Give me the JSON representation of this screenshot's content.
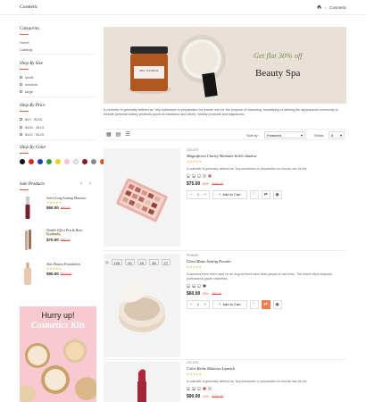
{
  "header": {
    "title": "Cosmetic",
    "breadcrumb_current": "Cosmetic",
    "home_icon": "home-icon"
  },
  "sidebar": {
    "categories_title": "Categories",
    "categories": [
      "Home",
      "Catalog"
    ],
    "size_title": "Shop By Size",
    "sizes": [
      "small",
      "medium",
      "large"
    ],
    "price_title": "Shop By Price",
    "prices": [
      "$10 - $100",
      "$100 - $110",
      "$110 - $120"
    ],
    "color_title": "Shop By Color",
    "colors": [
      "#111111",
      "#e0262b",
      "#1f3fb5",
      "#2e9e3a",
      "#f4d320",
      "#f3c1cf",
      "#e8e8e8",
      "#8a1c1c",
      "#8a8a8a",
      "#e0502e"
    ]
  },
  "sale": {
    "title": "Sale Products",
    "items": [
      {
        "name": "Sweet Long Lasting Mascara",
        "stars": "★★★★★",
        "price": "$60.00",
        "old": "$80.00"
      },
      {
        "name": "Double Effect Pen & Brow Eyeshado",
        "stars": "★★★★★",
        "price": "$70.00",
        "old": "$80.00"
      },
      {
        "name": "Skin Illusion Foundation",
        "stars": "★★★★★",
        "price": "$90.00",
        "old": "$100.00"
      }
    ]
  },
  "promo": {
    "line1": "Hurry up!",
    "line2": "Cosmetics Kits"
  },
  "banner": {
    "offer": "Get flat 30% off",
    "title": "Beauty Spa",
    "candle_label": "ABL CANDLE"
  },
  "category_description": "A cosmetic is generally defined as \"any substance or preparation for human use for the purpose of cleansing, beautifying or altering the appearance commonly to include personal toiletry products (such as shampoo and lotion), beauty products and fragrances.",
  "toolbar": {
    "sort_label": "Sort by:",
    "sort_value": "Featured",
    "show_label": "Show:",
    "show_value": "8"
  },
  "products": [
    {
      "brand": "GELATE",
      "name": "Magnificent Clarity Shimmer brillo shadow",
      "stars": "★★★★★",
      "desc": "A cosmetic is generally defined as \"any substance or preparation for human use for the",
      "sizes": [
        "S",
        "M",
        "L"
      ],
      "price": "$75.00",
      "discount": "-50%",
      "old": "$150.00",
      "qty": "1",
      "cart_label": "Add to Cart"
    },
    {
      "brand": "PRIMAR",
      "name": "Ultra Matte Setting Powder",
      "stars": "★★★★★",
      "desc": "Cosmetics have been used for as long as there have been people to use them. The brand offers bespoke, professional-grade cosmetics.",
      "sizes": [
        "S",
        "M",
        "L"
      ],
      "price": "$60.00",
      "discount": "-25%",
      "old": "$80.00",
      "qty": "1",
      "cart_label": "Add to Cart",
      "countdown": [
        "126",
        "00",
        "00",
        "38",
        "27"
      ]
    },
    {
      "brand": "GELATE",
      "name": "Color Riche Mattetes Lipstick",
      "stars": "★★★★★",
      "desc": "A cosmetic is generally defined as \"any substance or preparation for human use for the",
      "sizes": [
        "S",
        "M",
        "L"
      ],
      "price": "$90.00",
      "discount": "-10%",
      "old": "$100.00"
    }
  ]
}
